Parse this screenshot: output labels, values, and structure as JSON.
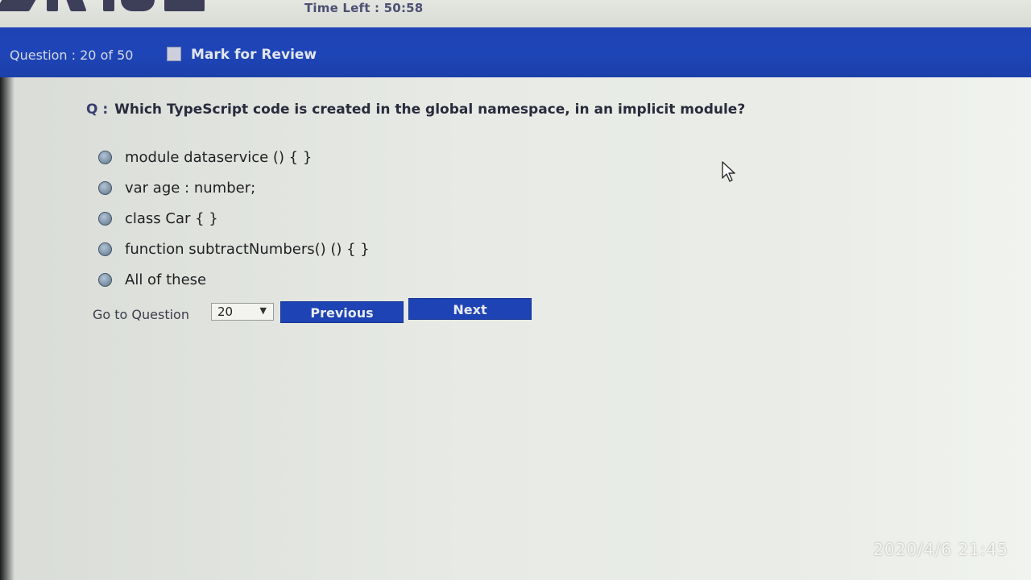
{
  "header": {
    "time_left": "Time Left : 50:58",
    "question_counter": "Question : 20 of 50",
    "mark_for_review_label": "Mark for Review"
  },
  "question": {
    "prefix": "Q :",
    "text": "Which TypeScript code is created in the global namespace, in an implicit module?",
    "options": [
      {
        "label": "module dataservice () { }"
      },
      {
        "label": "var age : number;"
      },
      {
        "label": "class Car { }"
      },
      {
        "label": "function subtractNumbers() () { }"
      },
      {
        "label": "All of these"
      }
    ]
  },
  "navigation": {
    "goto_label": "Go to Question",
    "goto_value": "20",
    "previous_label": "Previous",
    "next_label": "Next"
  },
  "overlay": {
    "timestamp": "2020/4/6  21:45"
  },
  "colors": {
    "header_blue": "#1e43b3",
    "button_blue": "#1d43b4",
    "background": "#e9ece8"
  }
}
